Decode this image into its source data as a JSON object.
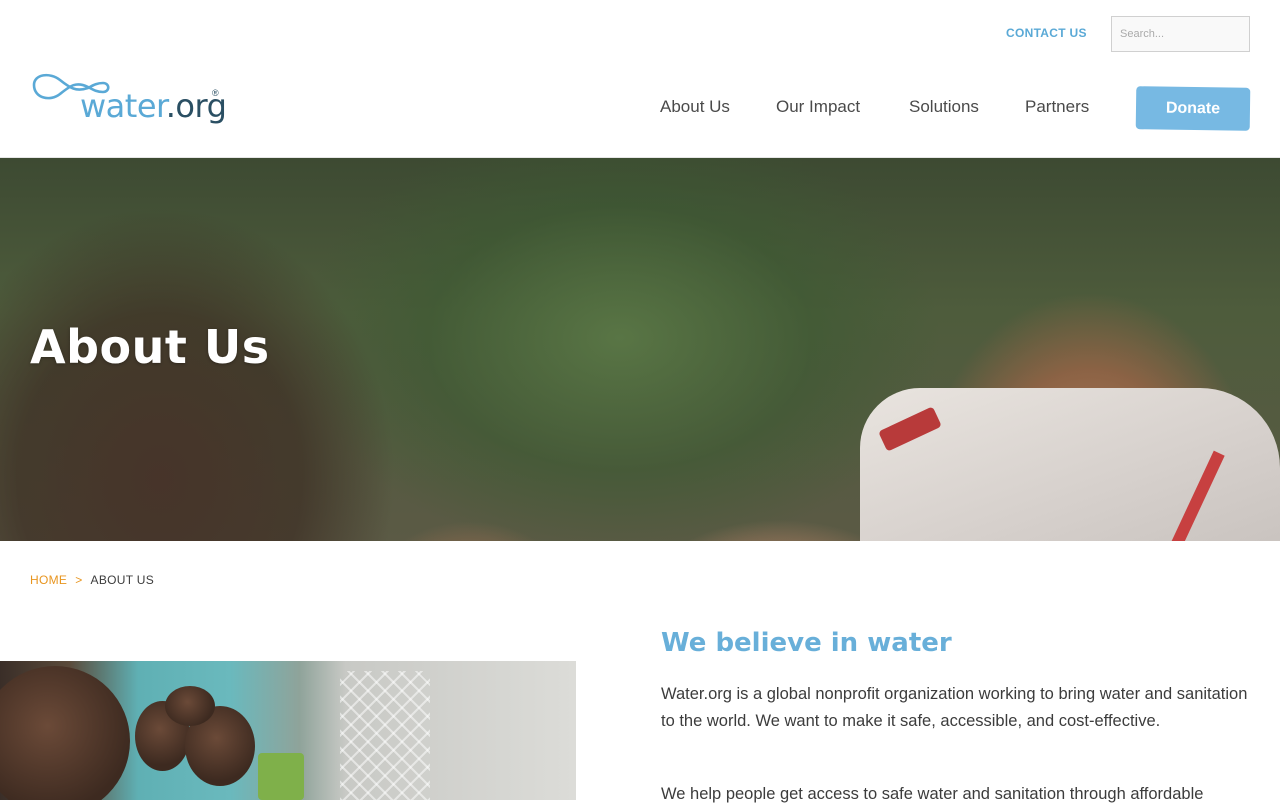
{
  "header": {
    "contact_label": "CONTACT US",
    "search_placeholder": "Search...",
    "logo": {
      "word_part1": "water",
      "word_part2": ".org",
      "registered": "®"
    },
    "nav": [
      {
        "label": "About Us"
      },
      {
        "label": "Our Impact"
      },
      {
        "label": "Solutions"
      },
      {
        "label": "Partners"
      }
    ],
    "donate_label": "Donate"
  },
  "hero": {
    "title": "About Us"
  },
  "breadcrumb": {
    "home": "HOME",
    "separator": ">",
    "current": "ABOUT US"
  },
  "content": {
    "heading": "We believe in water",
    "paragraphs": [
      "Water.org is a global nonprofit organization working to bring water and sanitation to the world. We want to make it safe, accessible, and cost-effective.",
      "We help people get access to safe water and sanitation through affordable"
    ]
  },
  "colors": {
    "accent": "#68afd9",
    "donate": "#77b9e3",
    "breadcrumb_link": "#e8951f",
    "logo_dark": "#2a4f63"
  },
  "icons": {
    "logo": "water-drop-infinity-icon"
  }
}
